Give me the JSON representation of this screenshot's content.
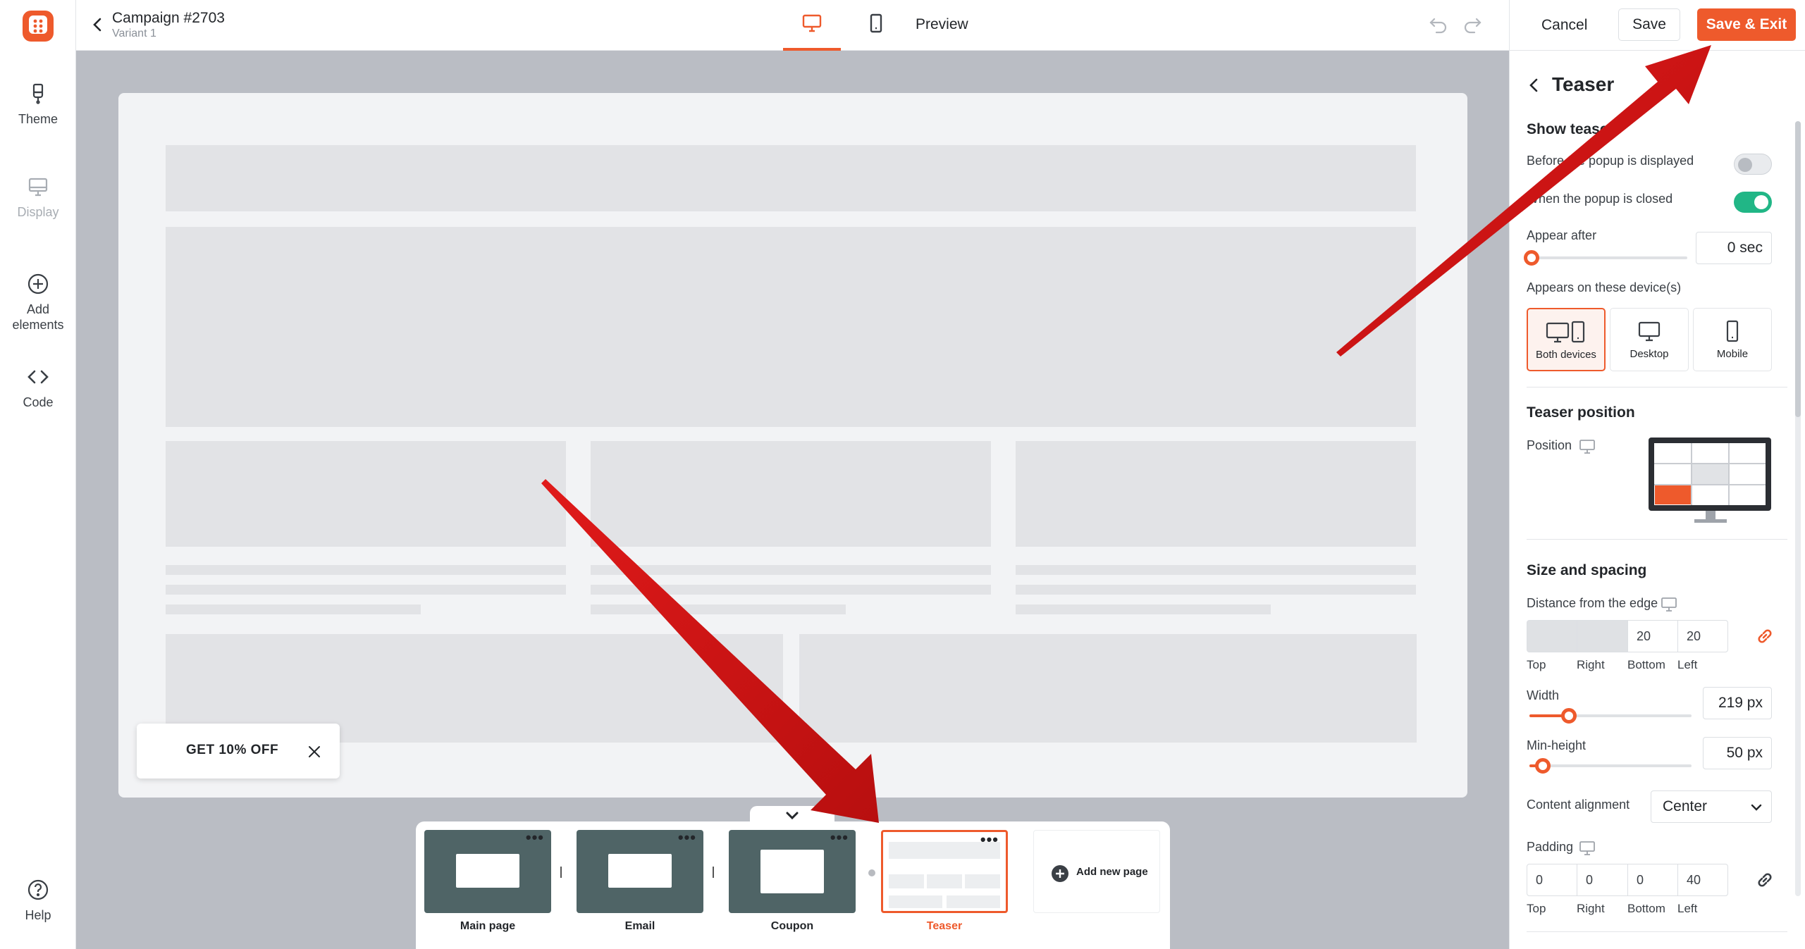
{
  "rail": {
    "items": [
      {
        "label": "Theme",
        "icon": "paintbrush-icon"
      },
      {
        "label": "Display",
        "icon": "monitor-icon",
        "disabled": true
      },
      {
        "label": "Add elements",
        "icon": "plus-circle-icon"
      },
      {
        "label": "Code",
        "icon": "code-icon"
      }
    ],
    "help_label": "Help"
  },
  "header": {
    "campaign_title": "Campaign #2703",
    "variant": "Variant 1",
    "preview_label": "Preview",
    "active_device": "desktop"
  },
  "actions": {
    "cancel": "Cancel",
    "save": "Save",
    "save_exit": "Save & Exit"
  },
  "colors": {
    "accent": "#ee5a2c",
    "toggle_on": "#21b686",
    "canvas_bg": "#babdc4",
    "thumb_bg": "#4f6466"
  },
  "canvas": {
    "teaser_text": "GET 10% OFF"
  },
  "pages": [
    {
      "label": "Main page"
    },
    {
      "label": "Email"
    },
    {
      "label": "Coupon"
    },
    {
      "label": "Teaser",
      "active": true
    }
  ],
  "add_page_label": "Add new page",
  "panel": {
    "title": "Teaser",
    "show_teaser": {
      "heading": "Show teaser",
      "before_label": "Before the popup is displayed",
      "before_on": false,
      "after_label": "When the popup is closed",
      "after_on": true
    },
    "appear_after": {
      "label": "Appear after",
      "value": "0 sec",
      "fraction": 0
    },
    "devices": {
      "label": "Appears on these device(s)",
      "options": [
        "Both devices",
        "Desktop",
        "Mobile"
      ],
      "selected": "Both devices"
    },
    "position": {
      "heading": "Teaser position",
      "label": "Position",
      "selected_cell": "bottom-left"
    },
    "size": {
      "heading": "Size and spacing",
      "distance_label": "Distance from the edge",
      "distance": {
        "top": "",
        "right": "",
        "bottom": "20",
        "left": "20"
      },
      "side_labels": [
        "Top",
        "Right",
        "Bottom",
        "Left"
      ],
      "width_label": "Width",
      "width_value": "219 px",
      "width_fraction": 0.24,
      "minheight_label": "Min-height",
      "minheight_value": "50 px",
      "minheight_fraction": 0.09,
      "alignment_label": "Content alignment",
      "alignment_value": "Center",
      "padding_label": "Padding",
      "padding": {
        "top": "0",
        "right": "0",
        "bottom": "0",
        "left": "40"
      }
    }
  }
}
